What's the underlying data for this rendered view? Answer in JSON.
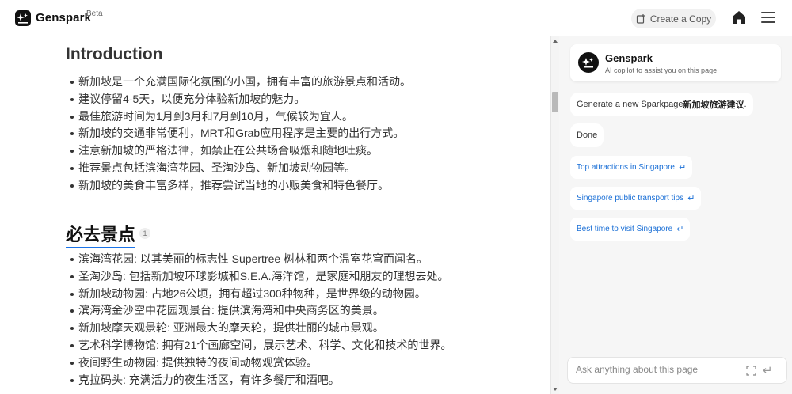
{
  "header": {
    "brand": "Genspark",
    "beta": "Beta",
    "create_copy": "Create a Copy"
  },
  "doc": {
    "intro_title": "Introduction",
    "intro_items": [
      "新加坡是一个充满国际化氛围的小国，拥有丰富的旅游景点和活动。",
      "建议停留4-5天，以便充分体验新加坡的魅力。",
      "最佳旅游时间为1月到3月和7月到10月，气候较为宜人。",
      "新加坡的交通非常便利，MRT和Grab应用程序是主要的出行方式。",
      "注意新加坡的严格法律，如禁止在公共场合吸烟和随地吐痰。",
      "推荐景点包括滨海湾花园、圣淘沙岛、新加坡动物园等。",
      "新加坡的美食丰富多样，推荐尝试当地的小贩美食和特色餐厅。"
    ],
    "section_title": "必去景点",
    "section_badge": "1",
    "section_items": [
      "滨海湾花园: 以其美丽的标志性 Supertree 树林和两个温室花穹而闻名。",
      "圣淘沙岛: 包括新加坡环球影城和S.E.A.海洋馆，是家庭和朋友的理想去处。",
      "新加坡动物园: 占地26公顷，拥有超过300种物种，是世界级的动物园。",
      "滨海湾金沙空中花园观景台: 提供滨海湾和中央商务区的美景。",
      "新加坡摩天观景轮: 亚洲最大的摩天轮，提供壮丽的城市景观。",
      "艺术科学博物馆: 拥有21个画廊空间，展示艺术、科学、文化和技术的世界。",
      "夜间野生动物园: 提供独特的夜间动物观赏体验。",
      "克拉码头: 充满活力的夜生活区，有许多餐厅和酒吧。"
    ]
  },
  "panel": {
    "copilot_name": "Genspark",
    "copilot_sub": "AI copilot to assist you on this page",
    "msg_prefix": "Generate a new Sparkpage ",
    "msg_bold": "新加坡旅游建议",
    "msg_suffix": ".",
    "msg_done": "Done",
    "suggestions": [
      "Top attractions in Singapore",
      "Singapore public transport tips",
      "Best time to visit Singapore"
    ],
    "ask_placeholder": "Ask anything about this page"
  },
  "icons": {
    "logo": "genspark-logo-icon",
    "copy": "copy-plus-icon",
    "home": "home-icon",
    "menu": "hamburger-menu-icon",
    "enter": "enter-return-icon",
    "expand": "expand-icon",
    "send": "send-return-icon"
  },
  "colors": {
    "accent": "#1a73e8",
    "link": "#1a6fd6",
    "panel_bg": "#f6f6f6"
  }
}
